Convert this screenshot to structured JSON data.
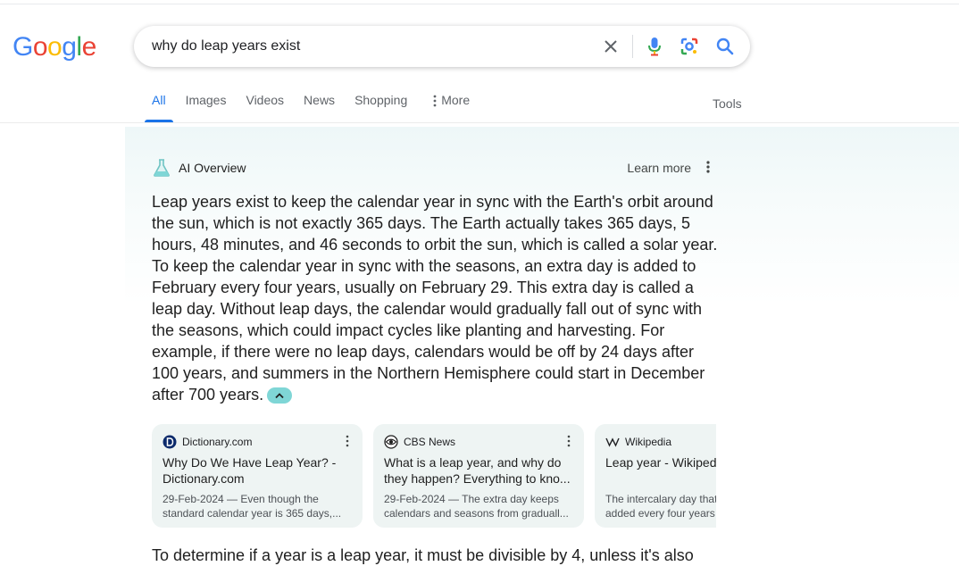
{
  "logo": {
    "letters": [
      "G",
      "o",
      "o",
      "g",
      "l",
      "e"
    ],
    "colors": [
      "#4285F4",
      "#EA4335",
      "#FBBC05",
      "#4285F4",
      "#34A853",
      "#EA4335"
    ]
  },
  "search": {
    "query": "why do leap years exist"
  },
  "tabs": [
    {
      "label": "All",
      "active": true
    },
    {
      "label": "Images"
    },
    {
      "label": "Videos"
    },
    {
      "label": "News"
    },
    {
      "label": "Shopping"
    },
    {
      "label": "More"
    }
  ],
  "tools_label": "Tools",
  "ai_overview": {
    "title": "AI Overview",
    "learn_more": "Learn more",
    "text": "Leap years exist to keep the calendar year in sync with the Earth's orbit around the sun, which is not exactly 365 days. The Earth actually takes 365 days, 5 hours, 48 minutes, and 46 seconds to orbit the sun, which is called a solar year. To keep the calendar year in sync with the seasons, an extra day is added to February every four years, usually on February 29. This extra day is called a leap day. Without leap days, the calendar would gradually fall out of sync with the seasons, which could impact cycles like planting and harvesting. For example, if there were no leap days, calendars would be off by 24 days after 100 years, and summers in the Northern Hemisphere could start in December after 700 years.",
    "cards": [
      {
        "source": "Dictionary.com",
        "title": "Why Do We Have Leap Year? - Dictionary.com",
        "snippet": "29-Feb-2024 — Even though the standard calendar year is 365 days,..."
      },
      {
        "source": "CBS News",
        "title": "What is a leap year, and why do they happen? Everything to kno...",
        "snippet": "29-Feb-2024 — The extra day keeps calendars and seasons from graduall..."
      },
      {
        "source": "Wikipedia",
        "title": "Leap year - Wikipedia",
        "snippet": "The intercalary day that is added every four years is called..."
      }
    ],
    "followup": "To determine if a year is a leap year, it must be divisible by 4, unless it's also"
  }
}
